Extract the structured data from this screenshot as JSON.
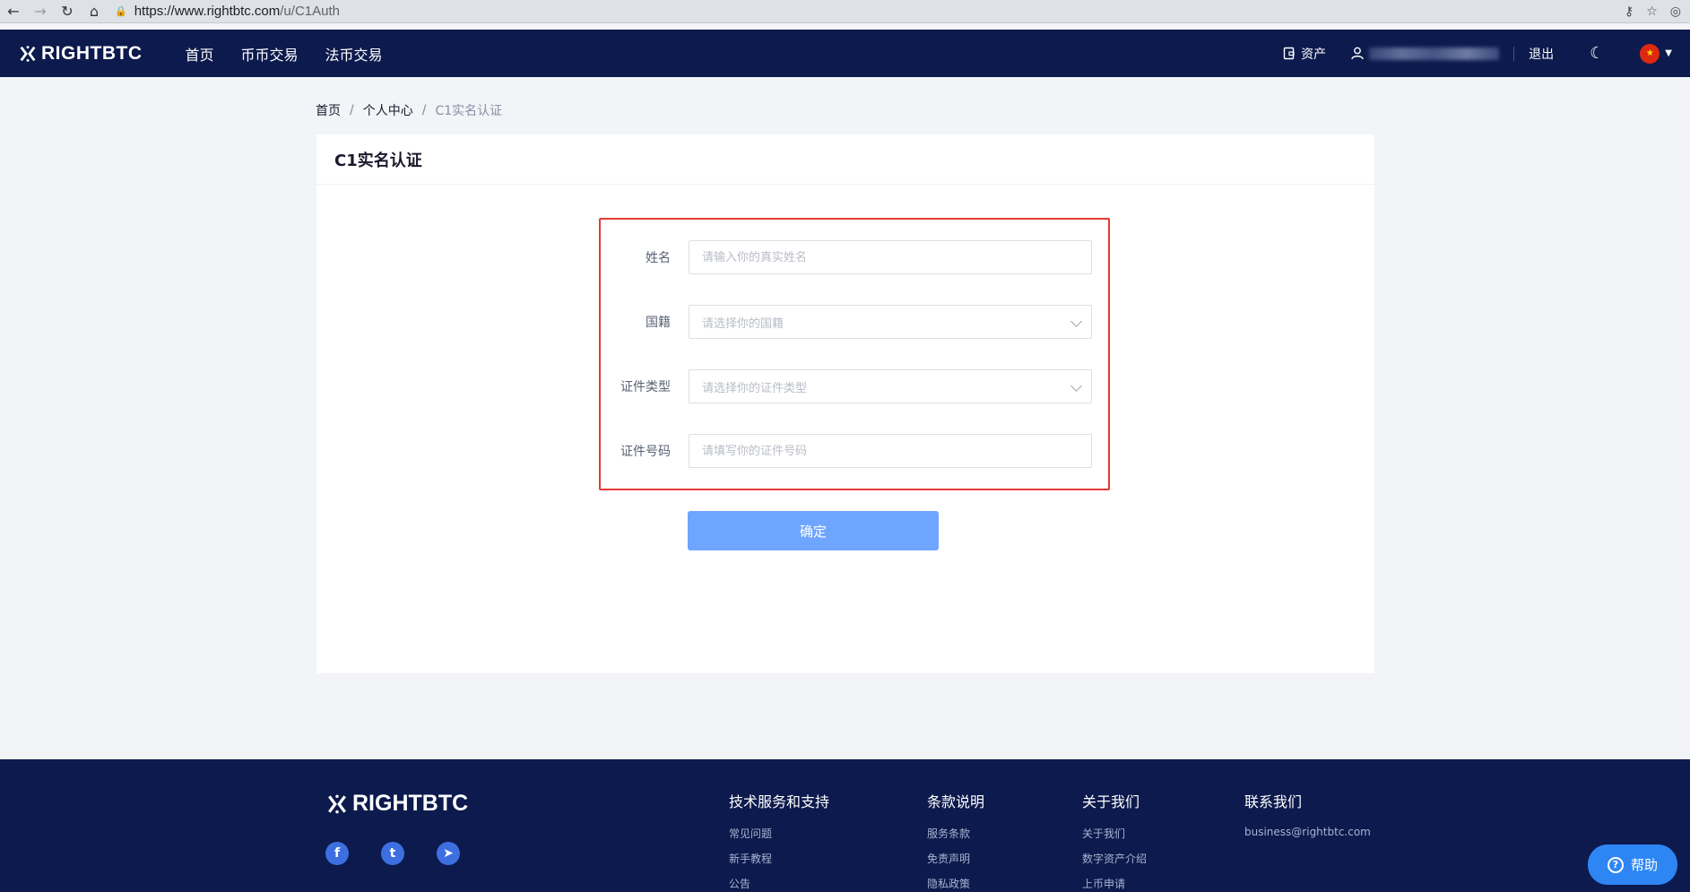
{
  "browser": {
    "url_host": "https://www.rightbtc.com",
    "url_path": "/u/C1Auth"
  },
  "header": {
    "logo_text": "RIGHTBTC",
    "nav": [
      {
        "label": "首页"
      },
      {
        "label": "币币交易"
      },
      {
        "label": "法币交易"
      }
    ],
    "assets_label": "资产",
    "logout_label": "退出"
  },
  "breadcrumb": {
    "home": "首页",
    "personal_center": "个人中心",
    "current": "C1实名认证",
    "separator": "/"
  },
  "card": {
    "title": "C1实名认证"
  },
  "form": {
    "name_label": "姓名",
    "name_placeholder": "请输入你的真实姓名",
    "nationality_label": "国籍",
    "nationality_placeholder": "请选择你的国籍",
    "id_type_label": "证件类型",
    "id_type_placeholder": "请选择你的证件类型",
    "id_number_label": "证件号码",
    "id_number_placeholder": "请填写你的证件号码",
    "submit_label": "确定"
  },
  "footer": {
    "logo_text": "RIGHTBTC",
    "columns": [
      {
        "title": "技术服务和支持",
        "links": [
          "常见问题",
          "新手教程",
          "公告"
        ]
      },
      {
        "title": "条款说明",
        "links": [
          "服务条款",
          "免责声明",
          "隐私政策"
        ]
      },
      {
        "title": "关于我们",
        "links": [
          "关于我们",
          "数字资产介绍",
          "上币申请"
        ]
      },
      {
        "title": "联系我们",
        "links": [
          "business@rightbtc.com"
        ]
      }
    ],
    "social": [
      {
        "icon": "facebook-icon",
        "glyph": "f"
      },
      {
        "icon": "twitter-icon",
        "glyph": "t"
      },
      {
        "icon": "telegram-icon",
        "glyph": "➤"
      }
    ]
  },
  "help_button": {
    "label": "帮助"
  },
  "colors": {
    "navy": "#0c1a4d",
    "primary_button": "#6ea5ff",
    "highlight_border": "#e53935",
    "help_button": "#2e86f5"
  }
}
